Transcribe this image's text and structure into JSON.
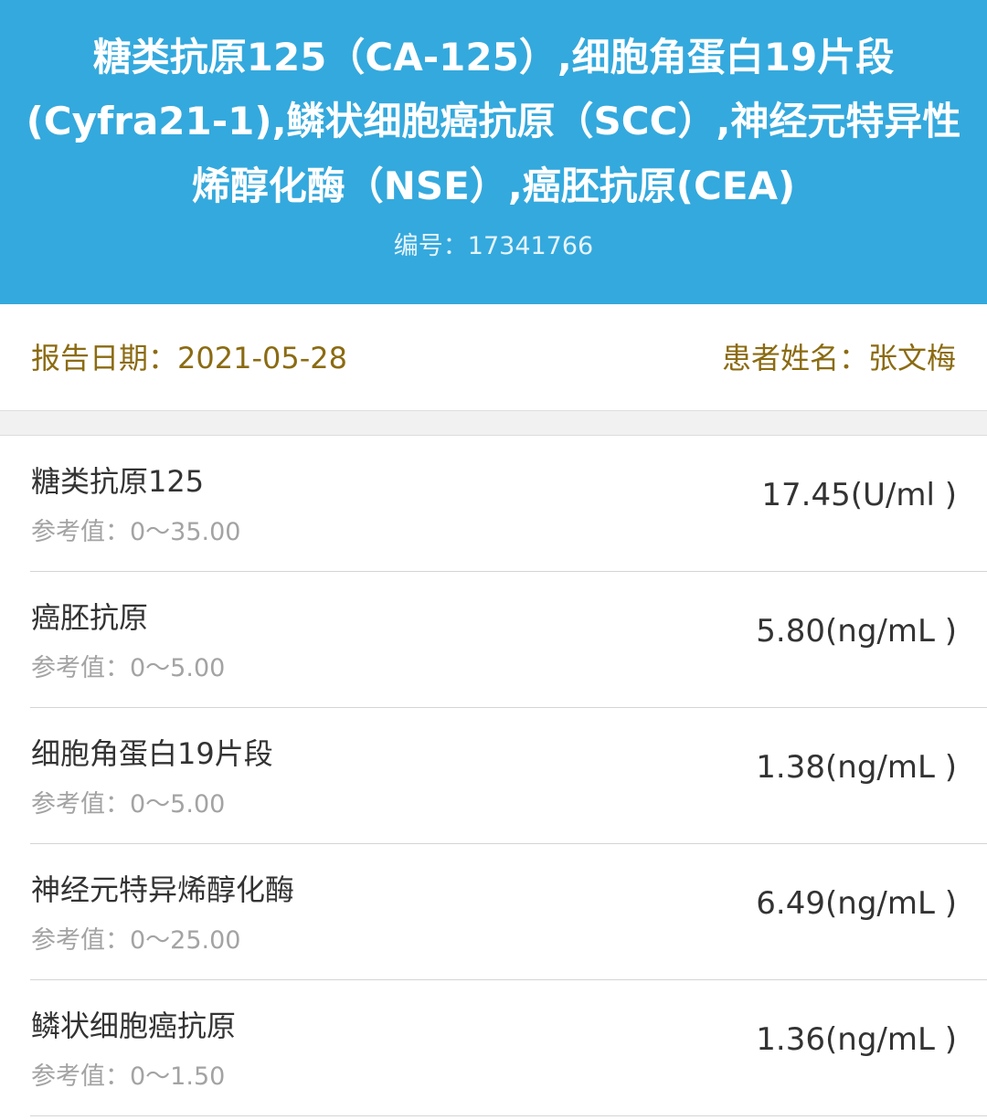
{
  "header": {
    "title_lines": [
      "糖类抗原125（CA-125）,细胞角蛋白19片段",
      "(Cyfra21-1),鳞状细胞癌抗原（SCC）,神经元特异性",
      "烯醇化酶（NSE）,癌胚抗原(CEA)"
    ],
    "serial_label": "编号：",
    "serial_value": "17341766",
    "serial_text": "编号：17341766"
  },
  "info": {
    "date_label": "报告日期：",
    "date_value": "2021-05-28",
    "date_text": "报告日期：2021-05-28",
    "patient_label": "患者姓名：",
    "patient_value": "张文梅",
    "patient_text": "患者姓名：张文梅"
  },
  "results": [
    {
      "name": "糖类抗原125",
      "ref_label": "参考值：",
      "ref_range": "0～35.00",
      "ref_text": "参考值：0～35.00",
      "value": "17.45(U/ml )"
    },
    {
      "name": "癌胚抗原",
      "ref_label": "参考值：",
      "ref_range": "0～5.00",
      "ref_text": "参考值：0～5.00",
      "value": "5.80(ng/mL )"
    },
    {
      "name": "细胞角蛋白19片段",
      "ref_label": "参考值：",
      "ref_range": "0～5.00",
      "ref_text": "参考值：0～5.00",
      "value": "1.38(ng/mL )"
    },
    {
      "name": "神经元特异烯醇化酶",
      "ref_label": "参考值：",
      "ref_range": "0～25.00",
      "ref_text": "参考值：0～25.00",
      "value": "6.49(ng/mL )"
    },
    {
      "name": "鳞状细胞癌抗原",
      "ref_label": "参考值：",
      "ref_range": "0～1.50",
      "ref_text": "参考值：0～1.50",
      "value": "1.36(ng/mL )"
    }
  ],
  "colors": {
    "header_bg": "#34a9dd",
    "header_text": "#ffffff",
    "info_text": "#8b6b12",
    "item_text": "#333333",
    "ref_text": "#a3a3a3"
  }
}
